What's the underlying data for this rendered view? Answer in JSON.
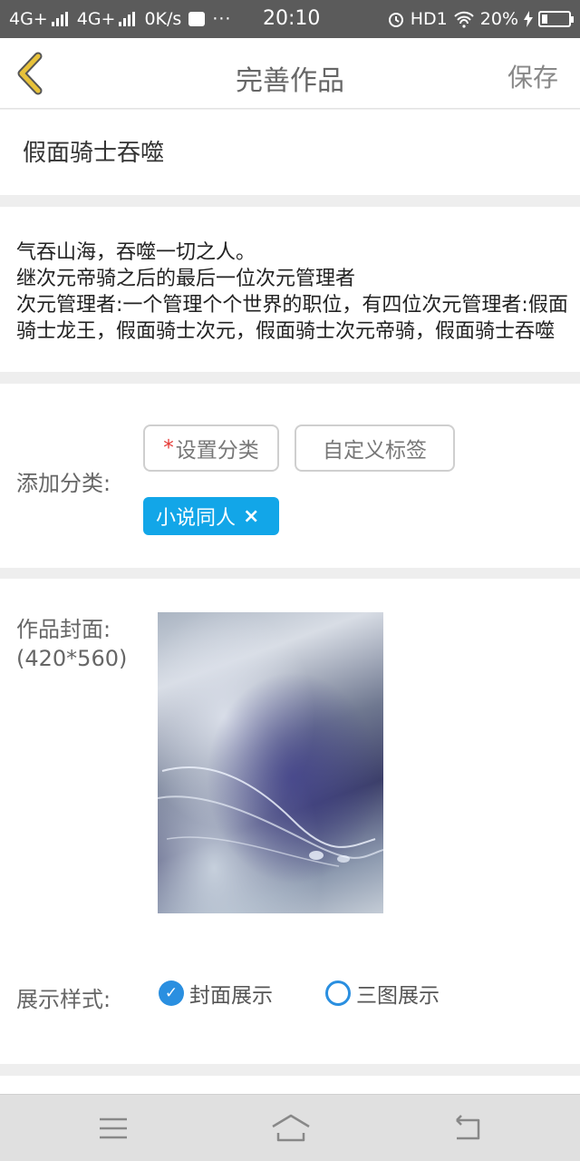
{
  "status_bar": {
    "network1": "4G+",
    "network2": "4G+",
    "speed": "0K/s",
    "dots": "···",
    "time": "20:10",
    "hd": "HD1",
    "battery": "20%"
  },
  "nav": {
    "title": "完善作品",
    "save_label": "保存",
    "back_icon": "chevron-left-icon"
  },
  "work": {
    "title": "假面骑士吞噬",
    "description": "气吞山海，吞噬一切之人。\n继次元帝骑之后的最后一位次元管理者\n次元管理者:一个管理个个世界的职位，有四位次元管理者:假面骑士龙王，假面骑士次元，假面骑士次元帝骑，假面骑士吞噬"
  },
  "category": {
    "label": "添加分类:",
    "set_category_required": "*",
    "set_category_label": "设置分类",
    "custom_tag_label": "自定义标签",
    "selected_tag": "小说同人",
    "remove_icon": "×"
  },
  "cover": {
    "label": "作品封面:",
    "size_hint": "(420*560)"
  },
  "display_style": {
    "label": "展示样式:",
    "options": [
      {
        "label": "封面展示",
        "selected": true
      },
      {
        "label": "三图展示",
        "selected": false
      }
    ]
  },
  "colors": {
    "accent": "#12a6e8",
    "radio": "#2a8fe0",
    "back_arrow": "#e8c23a",
    "required": "#e53935"
  }
}
